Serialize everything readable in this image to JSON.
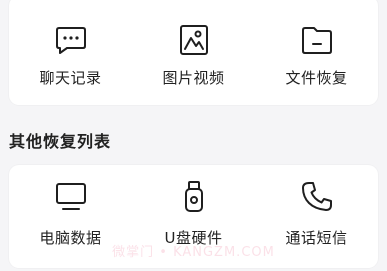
{
  "recovery_options": [
    {
      "label": "聊天记录",
      "icon": "chat-icon"
    },
    {
      "label": "图片视频",
      "icon": "image-icon"
    },
    {
      "label": "文件恢复",
      "icon": "folder-icon"
    }
  ],
  "other_section": {
    "title": "其他恢复列表",
    "items": [
      {
        "label": "电脑数据",
        "icon": "monitor-icon"
      },
      {
        "label": "U盘硬件",
        "icon": "usb-drive-icon"
      },
      {
        "label": "通话短信",
        "icon": "phone-icon"
      }
    ]
  },
  "watermark": "微掌门 • KANGZM.COM"
}
